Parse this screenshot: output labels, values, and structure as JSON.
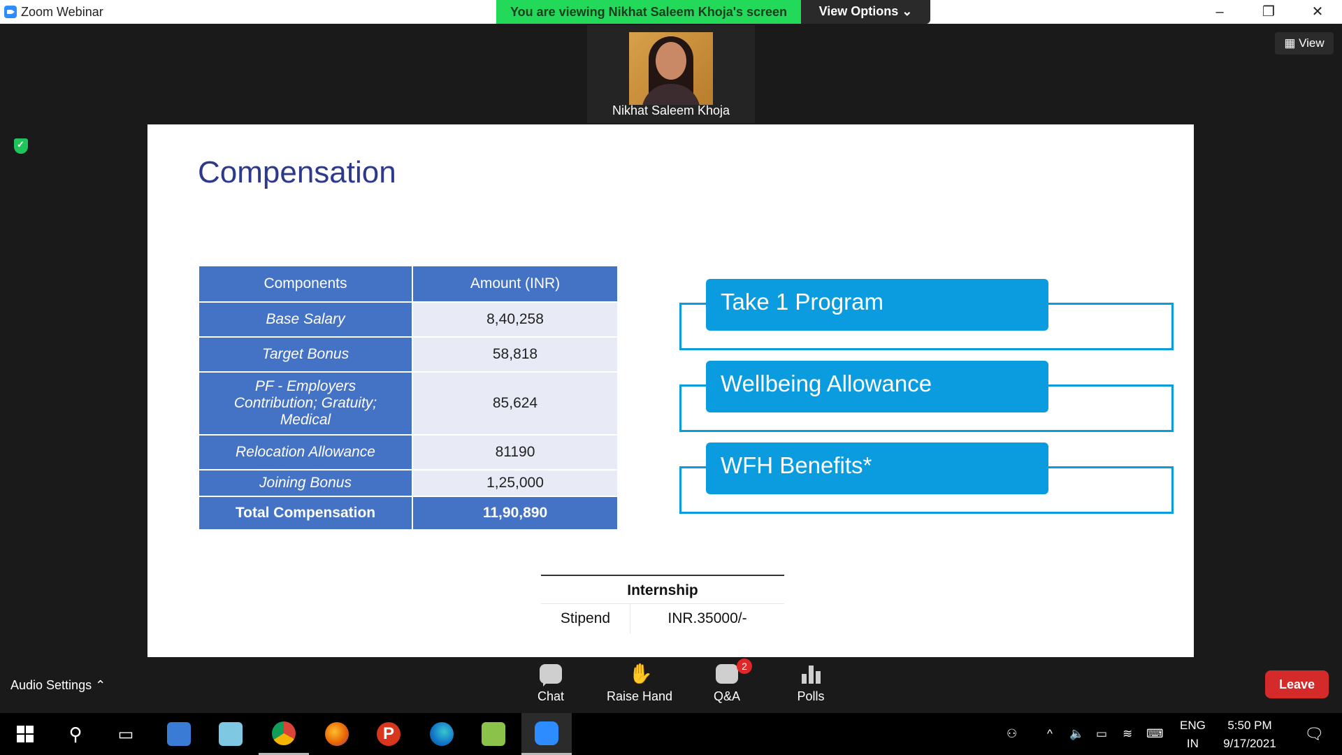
{
  "window": {
    "app_title": "Zoom Webinar",
    "viewing_banner": "You are viewing Nikhat Saleem Khoja's screen",
    "view_options_label": "View Options",
    "view_label": "View"
  },
  "presenter": {
    "name": "Nikhat Saleem Khoja"
  },
  "slide": {
    "title": "Compensation",
    "table": {
      "headers": [
        "Components",
        "Amount (INR)"
      ],
      "rows": [
        {
          "component": "Base Salary",
          "amount": "8,40,258"
        },
        {
          "component": "Target Bonus",
          "amount": "58,818"
        },
        {
          "component": "PF - Employers Contribution; Gratuity; Medical",
          "amount": "85,624"
        },
        {
          "component": "Relocation Allowance",
          "amount": "81190"
        },
        {
          "component": "Joining Bonus",
          "amount": "1,25,000"
        }
      ],
      "total": {
        "component": "Total Compensation",
        "amount": "11,90,890"
      }
    },
    "benefits": [
      "Take 1 Program",
      "Wellbeing Allowance",
      "WFH Benefits*"
    ],
    "internship": {
      "heading": "Internship",
      "label": "Stipend",
      "value": "INR.35000/-"
    }
  },
  "toolbar": {
    "audio_settings": "Audio Settings",
    "chat": "Chat",
    "raise_hand": "Raise Hand",
    "qa": "Q&A",
    "qa_badge": "2",
    "polls": "Polls",
    "leave": "Leave"
  },
  "taskbar": {
    "lang_top": "ENG",
    "lang_bottom": "IN",
    "time": "5:50 PM",
    "date": "9/17/2021",
    "apps": [
      "start",
      "search",
      "task-view",
      "this-pc",
      "notepad",
      "chrome",
      "firefox",
      "pixlr",
      "edge",
      "notepad-plus",
      "zoom"
    ]
  },
  "colors": {
    "banner_green": "#23d959",
    "table_blue": "#4472c4",
    "benefit_blue": "#0a9cde",
    "slide_title": "#2d3a8c",
    "leave_red": "#d42a2a"
  }
}
